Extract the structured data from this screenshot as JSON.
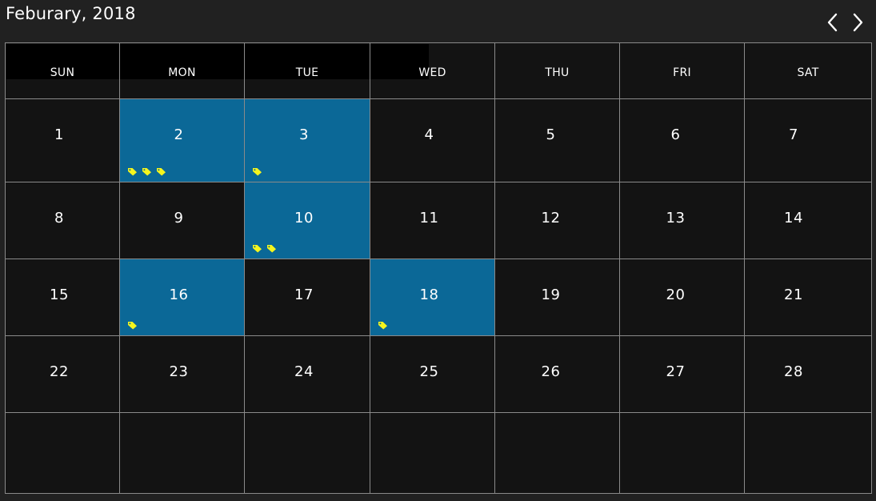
{
  "header": {
    "month_title": "Feburary, 2018",
    "prev_icon": "chevron-left-icon",
    "next_icon": "chevron-right-icon"
  },
  "weekdays": [
    "SUN",
    "MON",
    "TUE",
    "WED",
    "THU",
    "FRI",
    "SAT"
  ],
  "colors": {
    "background": "#212121",
    "cell_background": "#131313",
    "highlight": "#0b6897",
    "tag": "#f5f51e",
    "grid_line": "#8a8a8a"
  },
  "tag_icon": "tag-icon",
  "weeks": [
    [
      {
        "day": "1",
        "highlight": false,
        "tags": 0
      },
      {
        "day": "2",
        "highlight": true,
        "tags": 3
      },
      {
        "day": "3",
        "highlight": true,
        "tags": 1
      },
      {
        "day": "4",
        "highlight": false,
        "tags": 0
      },
      {
        "day": "5",
        "highlight": false,
        "tags": 0
      },
      {
        "day": "6",
        "highlight": false,
        "tags": 0
      },
      {
        "day": "7",
        "highlight": false,
        "tags": 0
      }
    ],
    [
      {
        "day": "8",
        "highlight": false,
        "tags": 0
      },
      {
        "day": "9",
        "highlight": false,
        "tags": 0
      },
      {
        "day": "10",
        "highlight": true,
        "tags": 2
      },
      {
        "day": "11",
        "highlight": false,
        "tags": 0
      },
      {
        "day": "12",
        "highlight": false,
        "tags": 0
      },
      {
        "day": "13",
        "highlight": false,
        "tags": 0
      },
      {
        "day": "14",
        "highlight": false,
        "tags": 0
      }
    ],
    [
      {
        "day": "15",
        "highlight": false,
        "tags": 0
      },
      {
        "day": "16",
        "highlight": true,
        "tags": 1
      },
      {
        "day": "17",
        "highlight": false,
        "tags": 0
      },
      {
        "day": "18",
        "highlight": true,
        "tags": 1
      },
      {
        "day": "19",
        "highlight": false,
        "tags": 0
      },
      {
        "day": "20",
        "highlight": false,
        "tags": 0
      },
      {
        "day": "21",
        "highlight": false,
        "tags": 0
      }
    ],
    [
      {
        "day": "22",
        "highlight": false,
        "tags": 0
      },
      {
        "day": "23",
        "highlight": false,
        "tags": 0
      },
      {
        "day": "24",
        "highlight": false,
        "tags": 0
      },
      {
        "day": "25",
        "highlight": false,
        "tags": 0
      },
      {
        "day": "26",
        "highlight": false,
        "tags": 0
      },
      {
        "day": "27",
        "highlight": false,
        "tags": 0
      },
      {
        "day": "28",
        "highlight": false,
        "tags": 0
      }
    ],
    [
      {
        "day": "",
        "highlight": false,
        "tags": 0
      },
      {
        "day": "",
        "highlight": false,
        "tags": 0
      },
      {
        "day": "",
        "highlight": false,
        "tags": 0
      },
      {
        "day": "",
        "highlight": false,
        "tags": 0
      },
      {
        "day": "",
        "highlight": false,
        "tags": 0
      },
      {
        "day": "",
        "highlight": false,
        "tags": 0
      },
      {
        "day": "",
        "highlight": false,
        "tags": 0
      }
    ]
  ]
}
